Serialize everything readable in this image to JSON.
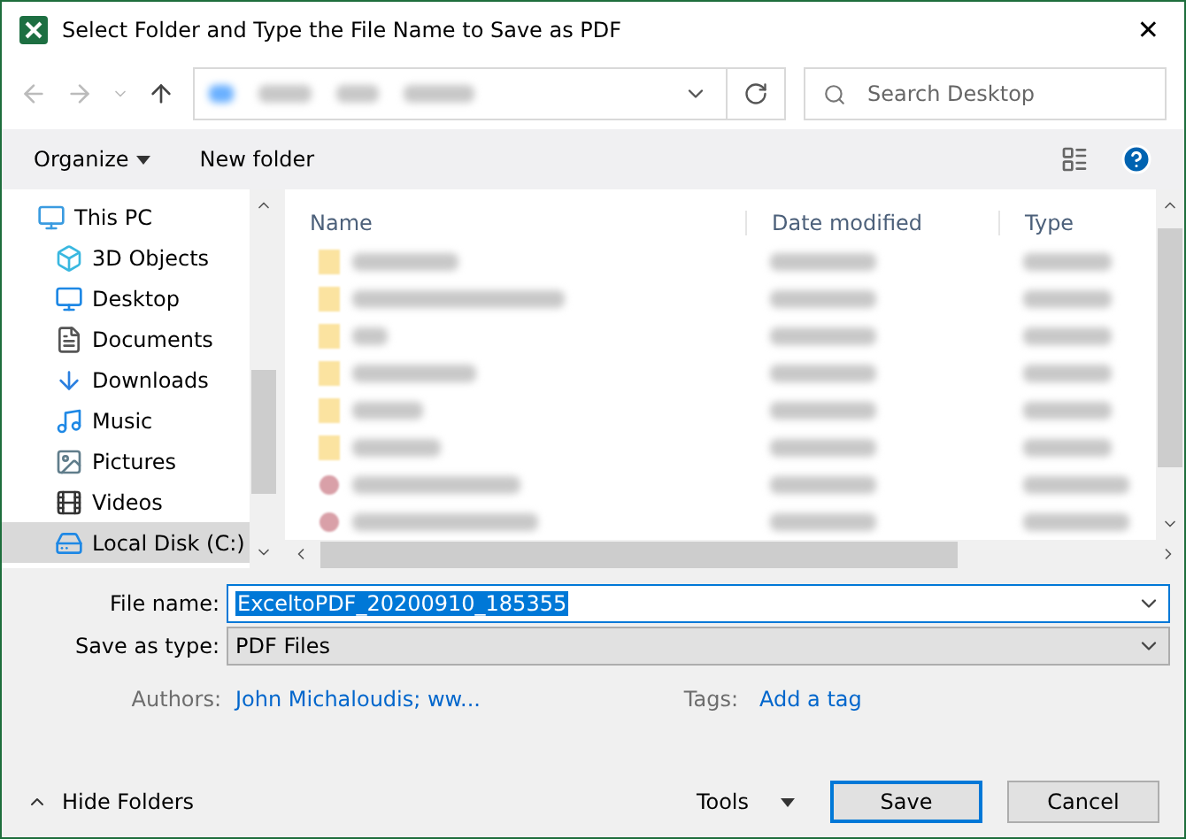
{
  "window": {
    "title": "Select Folder and Type the File Name to Save as PDF",
    "close": "✕"
  },
  "address": {
    "search_placeholder": "Search Desktop"
  },
  "toolbar": {
    "organize": "Organize",
    "new_folder": "New folder"
  },
  "nav": [
    {
      "label": "This PC",
      "kind": "pc",
      "selected": false,
      "children": [
        {
          "label": "3D Objects",
          "kind": "cube",
          "selected": false
        },
        {
          "label": "Desktop",
          "kind": "desktop",
          "selected": false
        },
        {
          "label": "Documents",
          "kind": "documents",
          "selected": false
        },
        {
          "label": "Downloads",
          "kind": "downloads",
          "selected": false
        },
        {
          "label": "Music",
          "kind": "music",
          "selected": false
        },
        {
          "label": "Pictures",
          "kind": "pictures",
          "selected": false
        },
        {
          "label": "Videos",
          "kind": "videos",
          "selected": false
        },
        {
          "label": "Local Disk (C:)",
          "kind": "disk",
          "selected": true
        }
      ]
    }
  ],
  "columns": [
    "Name",
    "Date modified",
    "Type"
  ],
  "files": [
    {
      "kind": "folder"
    },
    {
      "kind": "folder"
    },
    {
      "kind": "folder"
    },
    {
      "kind": "folder"
    },
    {
      "kind": "folder"
    },
    {
      "kind": "folder"
    },
    {
      "kind": "pdf"
    },
    {
      "kind": "pdf"
    }
  ],
  "form": {
    "file_name_label": "File name:",
    "file_name": "ExceltoPDF_20200910_185355",
    "type_label": "Save as type:",
    "type": "PDF Files",
    "authors_label": "Authors:",
    "authors": "John Michaloudis; ww...",
    "tags_label": "Tags:",
    "tags": "Add a tag"
  },
  "footer": {
    "hide_folders": "Hide Folders",
    "tools": "Tools",
    "save": "Save",
    "cancel": "Cancel"
  }
}
